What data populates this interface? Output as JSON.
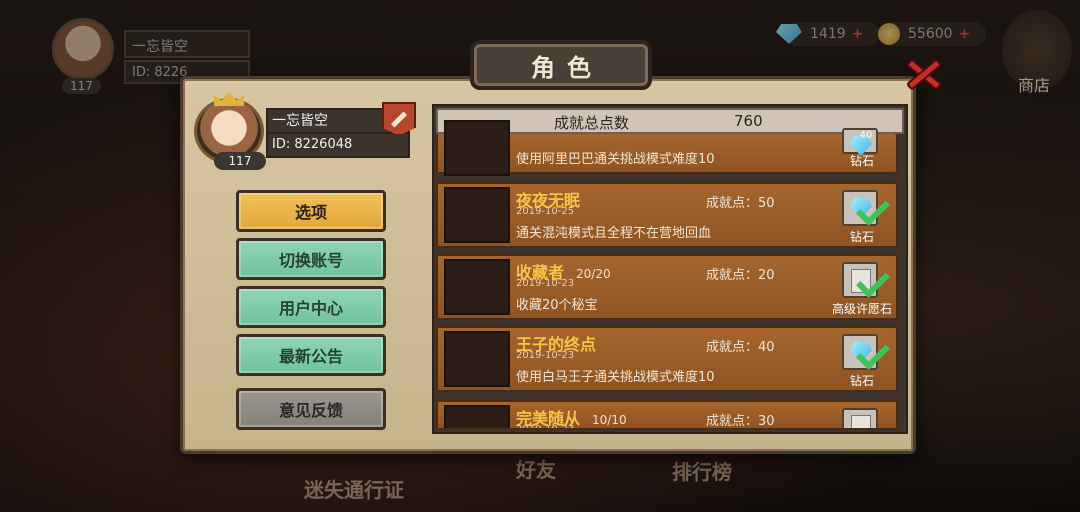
{
  "background": {
    "player_name": "一忘皆空",
    "player_id": "ID: 8226",
    "level": "117",
    "bottom_labels": [
      "迷失通行证",
      "好友",
      "排行榜"
    ]
  },
  "currency": {
    "gems": "1419",
    "gold": "55600"
  },
  "shop_label": "商店",
  "panel": {
    "title": "角色",
    "profile": {
      "name": "一忘皆空",
      "id": "ID: 8226048",
      "level": "117"
    },
    "menu": [
      {
        "label": "选项",
        "state": "active"
      },
      {
        "label": "切换账号",
        "state": "normal"
      },
      {
        "label": "用户中心",
        "state": "normal"
      },
      {
        "label": "最新公告",
        "state": "normal"
      },
      {
        "label": "意见反馈",
        "state": "disabled"
      }
    ],
    "achievements_header": {
      "label": "成就总点数",
      "value": "760"
    },
    "achievements": [
      {
        "name": "",
        "progress": "",
        "date": "",
        "description": "使用阿里巴巴通关挑战模式难度10",
        "points": "",
        "reward": "钻石",
        "reward_top": "40"
      },
      {
        "name": "夜夜无眠",
        "progress": "",
        "date": "2019-10-25",
        "description": "通关混沌模式且全程不在营地回血",
        "points": "成就点：50",
        "reward": "钻石"
      },
      {
        "name": "收藏者",
        "progress": "20/20",
        "date": "2019-10-23",
        "description": "收藏20个秘宝",
        "points": "成就点：20",
        "reward": "高级许愿石"
      },
      {
        "name": "王子的终点",
        "progress": "",
        "date": "2019-10-23",
        "description": "使用白马王子通关挑战模式难度10",
        "points": "成就点：40",
        "reward": "钻石"
      },
      {
        "name": "完美随从",
        "progress": "10/10",
        "date": "2019-10-23",
        "description": "",
        "points": "成就点：30",
        "reward": ""
      }
    ]
  }
}
